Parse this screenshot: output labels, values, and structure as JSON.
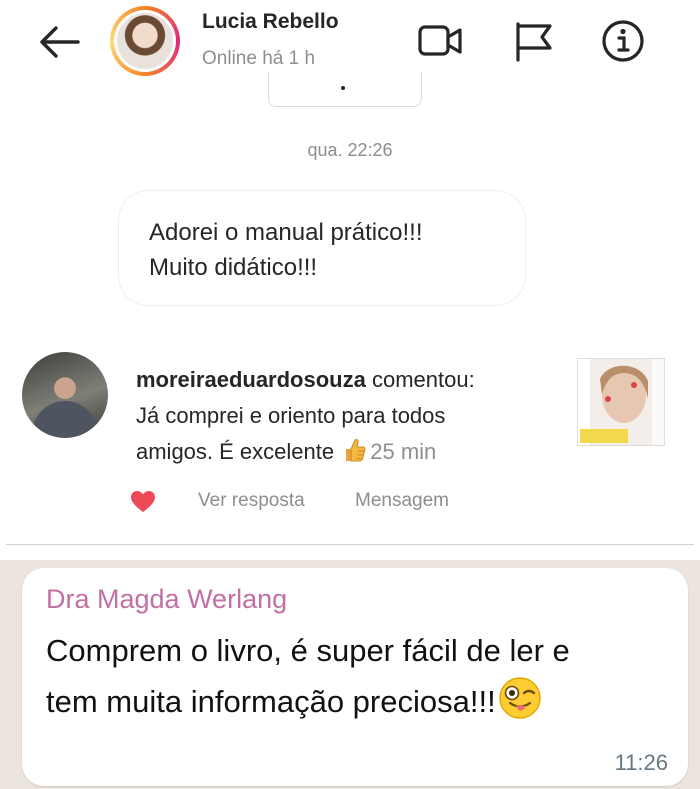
{
  "header": {
    "contact_name": "Lucia Rebello",
    "status": "Online há 1 h",
    "icons": [
      "back-arrow-icon",
      "video-call-icon",
      "flag-icon",
      "info-icon"
    ]
  },
  "chat": {
    "time_divider": "qua. 22:26",
    "message": {
      "lines": [
        "Adorei o manual prático!!!",
        "Muito didático!!!"
      ]
    },
    "comment": {
      "username": "moreiraeduardosouza",
      "verb": " comentou:",
      "lines": [
        "Já comprei e oriento para todos",
        "amigos.  É excelente"
      ],
      "emoji": "thumbs-up",
      "time": "25 min",
      "liked": true,
      "reply_label": "Ver resposta",
      "message_label": "Mensagem"
    }
  },
  "whatsapp_quote": {
    "sender": "Dra Magda Werlang",
    "lines": [
      "Comprem o livro, é super fácil de ler e",
      "tem muita informação preciosa!!!"
    ],
    "emoji": "winking-face-with-tongue",
    "time": "11:26"
  },
  "colors": {
    "accent_heart": "#ed4956",
    "secondary_text": "#8e8e8e",
    "whatsapp_sender": "#c36fa3",
    "whatsapp_background": "#ece5dd"
  }
}
